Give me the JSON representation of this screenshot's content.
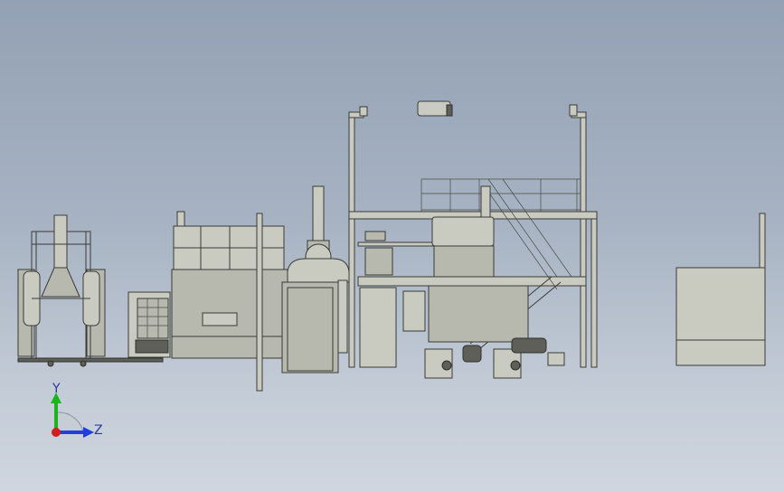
{
  "viewport": {
    "background_top": "#93a1b4",
    "background_bottom": "#cfd6df"
  },
  "model": {
    "color": "#c9cbc1",
    "edge_color": "#3a3b36"
  },
  "triad": {
    "y_label": "Y",
    "z_label": "Z",
    "y_color": "#19b619",
    "z_color": "#1f3fe0",
    "x_color": "#d21e1e"
  }
}
